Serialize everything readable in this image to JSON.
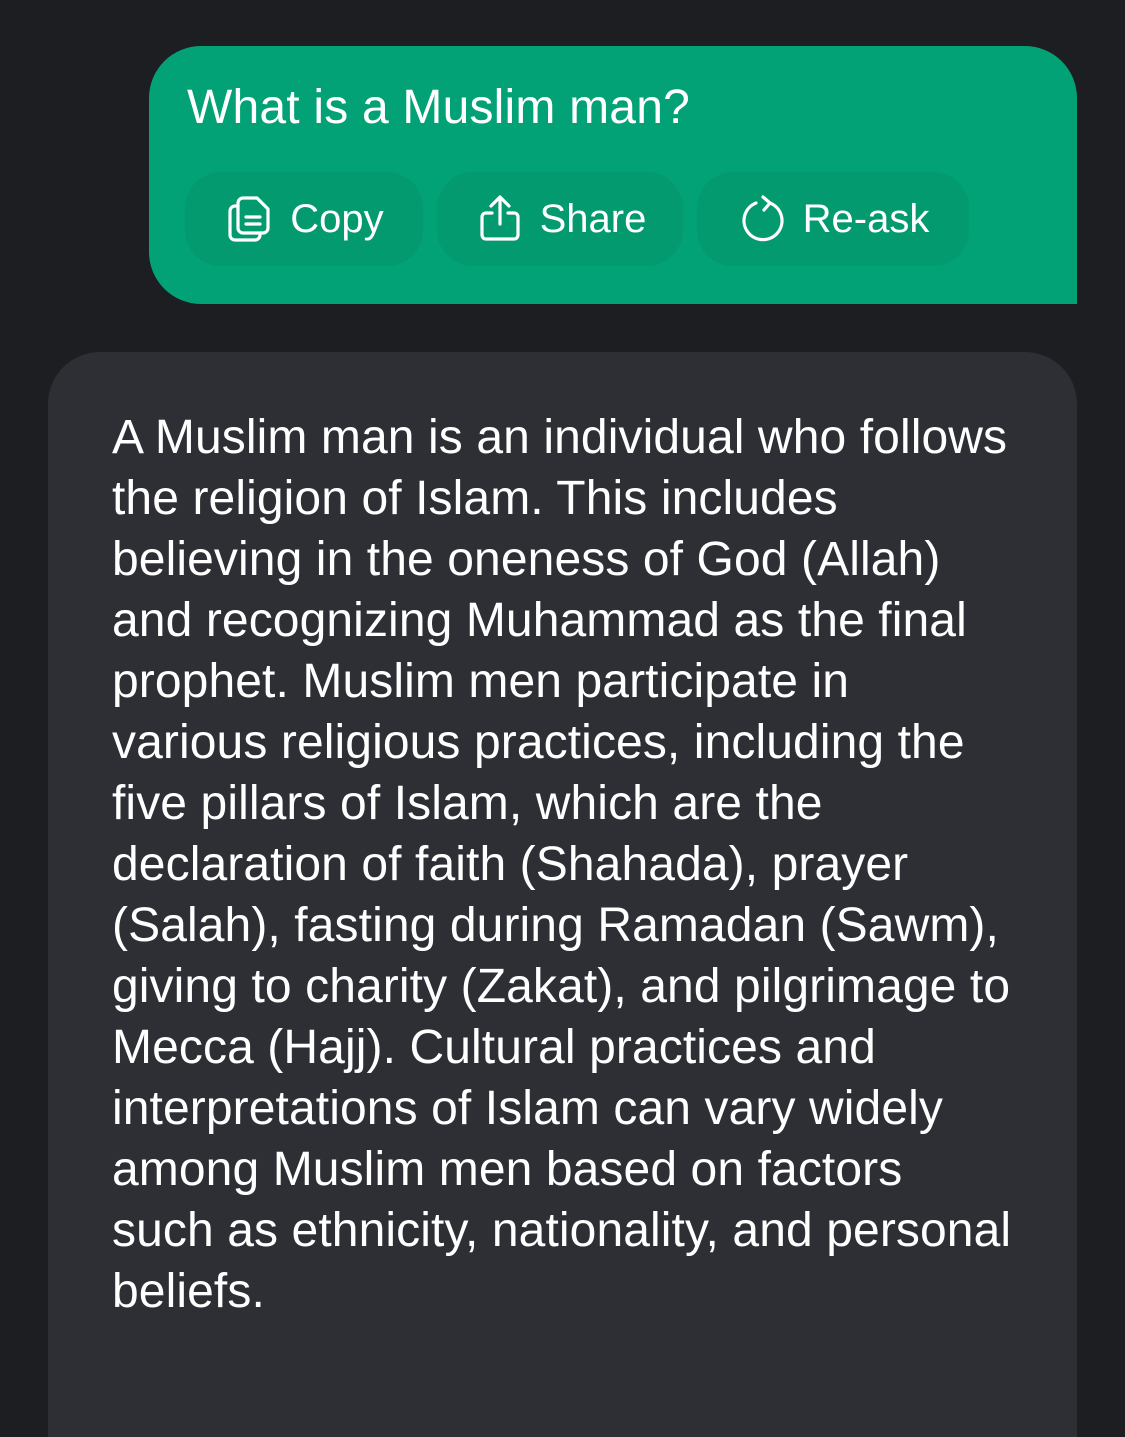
{
  "user_message": {
    "text": "What is a Muslim man?",
    "actions": {
      "copy_label": "Copy",
      "share_label": "Share",
      "reask_label": "Re-ask"
    }
  },
  "assistant_message": {
    "text": "A Muslim man is an individual who follows the religion of Islam. This includes believing in the oneness of God (Allah) and recognizing Muhammad as the final prophet. Muslim men participate in various religious practices, including the five pillars of Islam, which are the declaration of faith (Shahada), prayer (Salah), fasting during Ramadan (Sawm), giving to charity (Zakat), and pilgrimage to Mecca (Hajj). Cultural practices and interpretations of Islam can vary widely among Muslim men based on factors such as ethnicity, nationality, and personal beliefs."
  },
  "icons": {
    "copy": "copy-icon",
    "share": "share-icon",
    "reask": "refresh-icon"
  },
  "colors": {
    "background": "#1d1e22",
    "user_bubble": "#02a276",
    "action_button": "#049a6f",
    "assistant_bubble": "#2d2f35",
    "text": "#ffffff"
  }
}
